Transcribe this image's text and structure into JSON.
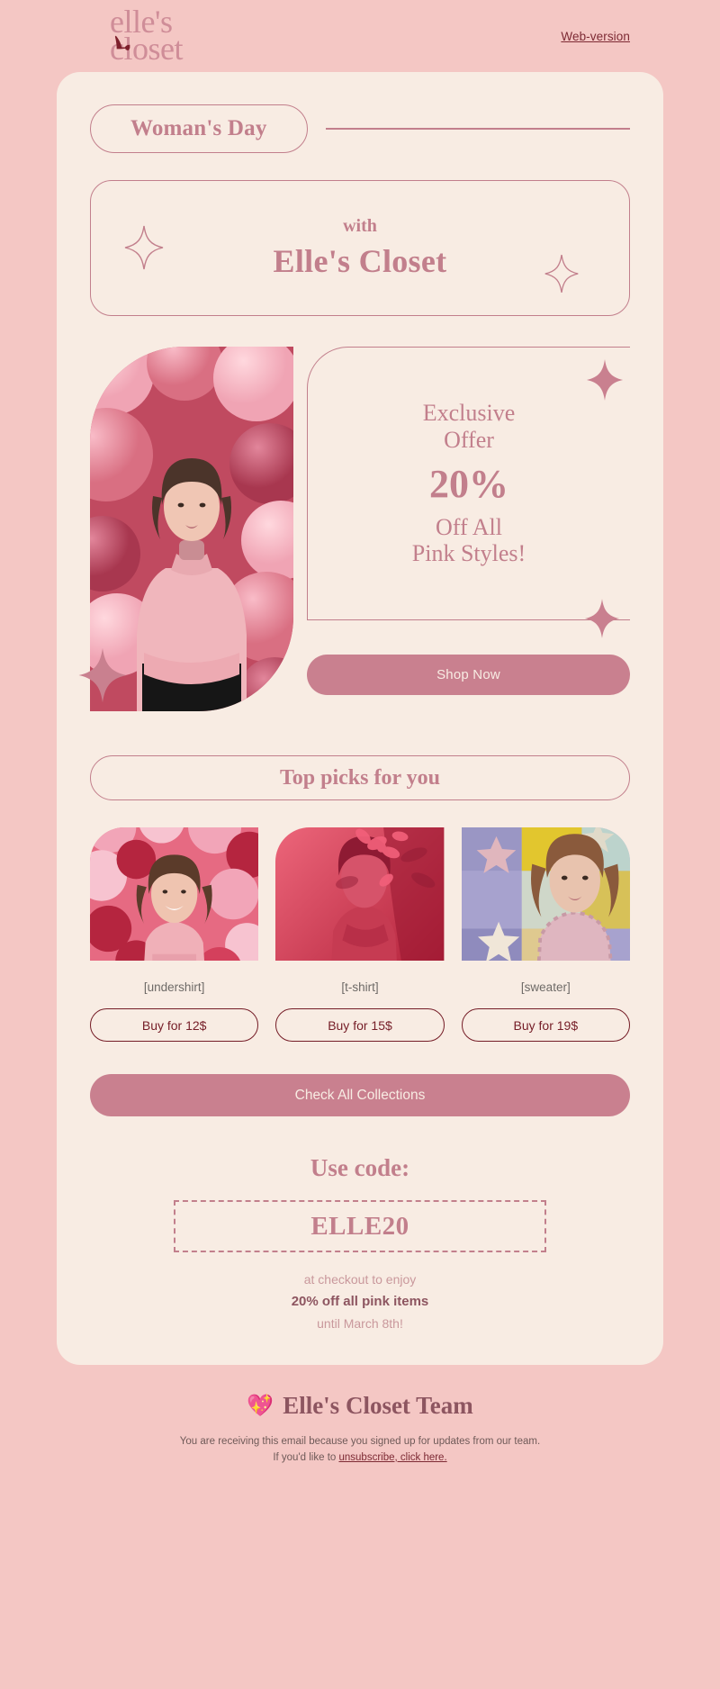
{
  "header": {
    "logo_line1": "elle's",
    "logo_line2": "closet",
    "logo_icon": "high-heel-shoe-icon",
    "web_version": "Web-version"
  },
  "hero": {
    "badge": "Woman's Day",
    "with": "with",
    "brand": "Elle's Closet",
    "sparkle_icon": "four-point-star-icon"
  },
  "offer": {
    "line1": "Exclusive",
    "line2": "Offer",
    "percent": "20%",
    "line3": "Off All",
    "line4": "Pink Styles!",
    "shop_button": "Shop Now",
    "photo_alt": "woman-in-pink-turtleneck-with-balloons"
  },
  "picks": {
    "title": "Top picks for you",
    "items": [
      {
        "label": "[undershirt]",
        "buy": "Buy for 12$",
        "photo_alt": "smiling-woman-in-pink-balloons"
      },
      {
        "label": "[t-shirt]",
        "buy": "Buy for 15$",
        "photo_alt": "woman-in-red-light-floral-shadow"
      },
      {
        "label": "[sweater]",
        "buy": "Buy for 19$",
        "photo_alt": "woman-with-star-pattern-backdrop"
      }
    ],
    "collections_button": "Check All Collections"
  },
  "promo": {
    "title": "Use code:",
    "code": "ELLE20",
    "sub1": "at checkout to enjoy",
    "sub2": "20% off all pink items",
    "sub3": "until March 8th!"
  },
  "footer": {
    "heart_icon": "💖",
    "team": "Elle's Closet Team",
    "fine_line1": "You are receiving this email because you signed up for updates from our team.",
    "fine_line2_pre": "If you'd like to ",
    "fine_link": "unsubscribe, click here."
  },
  "colors": {
    "page_bg": "#f4c7c4",
    "card_bg": "#f8ece3",
    "rose": "#c27f8c",
    "rose_fill": "#c9808f",
    "maroon": "#751d27",
    "dark_rose": "#8d5560"
  }
}
